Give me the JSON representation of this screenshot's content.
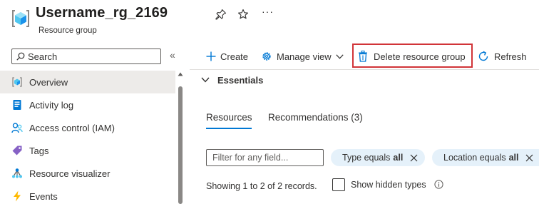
{
  "header": {
    "title": "Username_rg_2169",
    "subtitle": "Resource group",
    "icon": "resource-group-icon",
    "more_label": "···"
  },
  "sidebar": {
    "search_placeholder": "Search",
    "collapse_label": "«",
    "items": [
      {
        "label": "Overview",
        "icon": "overview-icon",
        "active": true
      },
      {
        "label": "Activity log",
        "icon": "activity-log-icon"
      },
      {
        "label": "Access control (IAM)",
        "icon": "iam-icon"
      },
      {
        "label": "Tags",
        "icon": "tag-icon"
      },
      {
        "label": "Resource visualizer",
        "icon": "visualizer-icon"
      },
      {
        "label": "Events",
        "icon": "events-icon"
      }
    ]
  },
  "toolbar": {
    "create_label": "Create",
    "manage_view_label": "Manage view",
    "delete_label": "Delete resource group",
    "refresh_label": "Refresh"
  },
  "essentials": {
    "label": "Essentials"
  },
  "tabs": [
    {
      "label": "Resources",
      "active": true
    },
    {
      "label": "Recommendations (3)"
    }
  ],
  "filters": {
    "placeholder": "Filter for any field...",
    "pills": [
      {
        "prefix": "Type equals",
        "value": "all"
      },
      {
        "prefix": "Location equals",
        "value": "all"
      }
    ]
  },
  "records": {
    "showing_text": "Showing 1 to 2 of 2 records.",
    "show_hidden_label": "Show hidden types"
  },
  "colors": {
    "accent": "#0078d4",
    "highlight_border": "#d13438",
    "pill_bg": "#e5f1fa",
    "nav_active_bg": "#edebe9"
  }
}
